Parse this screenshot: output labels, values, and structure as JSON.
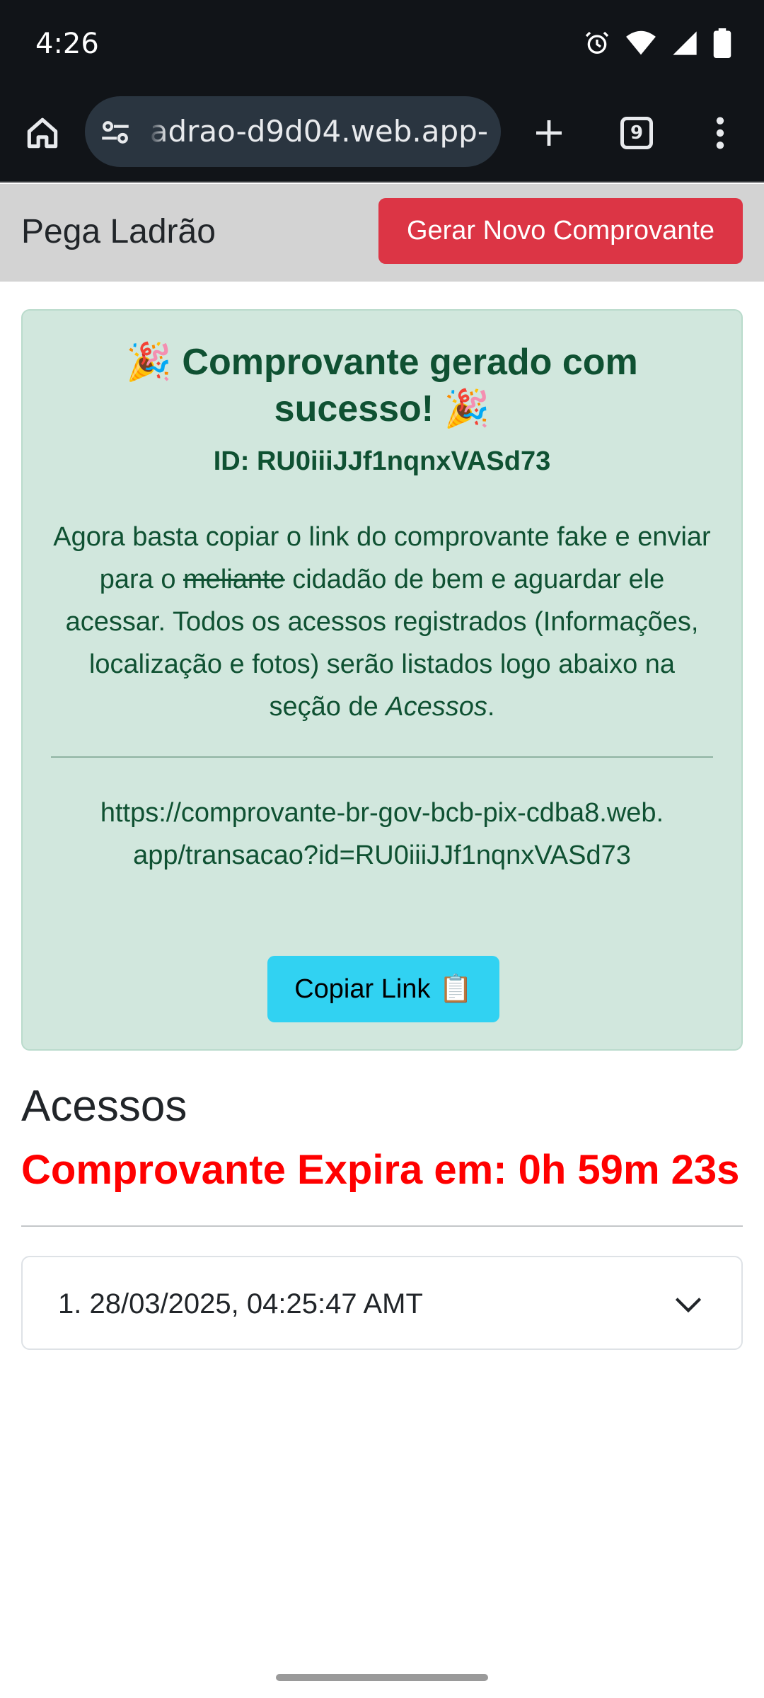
{
  "status_bar": {
    "time": "4:26",
    "icons": [
      "alarm-icon",
      "wifi-icon",
      "signal-icon",
      "battery-icon"
    ]
  },
  "browser": {
    "url": "-ladrao-d9d04.web.app",
    "tabs_count": "9",
    "icons": [
      "home-icon",
      "site-settings-icon",
      "plus-icon",
      "tabs-icon",
      "more-vert-icon"
    ]
  },
  "navbar": {
    "brand": "Pega Ladrão",
    "new_receipt_label": "Gerar Novo Comprovante",
    "new_receipt_color": "#dc3545"
  },
  "alert": {
    "title_emoji_left": "🎉",
    "title_text": "Comprovante gerado com sucesso!",
    "title_emoji_right": "🎉",
    "id_line": "ID: RU0iiiJJf1nqnxVASd73",
    "desc_part1": "Agora basta copiar o link do comprovante fake e enviar para o ",
    "desc_strike": "meliante",
    "desc_part2": " cidadão de bem e aguardar ele acessar. Todos os acessos registrados (Informações, localização e fotos) serão listados logo abaixo na seção de ",
    "desc_italic": "Acessos",
    "desc_end": ".",
    "link": "https://comprovante-br-gov-bcb-pix-cdba8.web.app/transacao?id=RU0iiiJJf1nqnxVASd73",
    "copy_label": "Copiar Link",
    "copy_emoji": "📋",
    "bg_color": "#d1e7dd",
    "text_color": "#0f5132"
  },
  "access": {
    "title": "Acessos",
    "expire_text": "Comprovante Expira em: 0h 59m 23s",
    "expire_color": "#ff0000",
    "items": [
      {
        "label": "1. 28/03/2025, 04:25:47 AMT"
      }
    ]
  }
}
